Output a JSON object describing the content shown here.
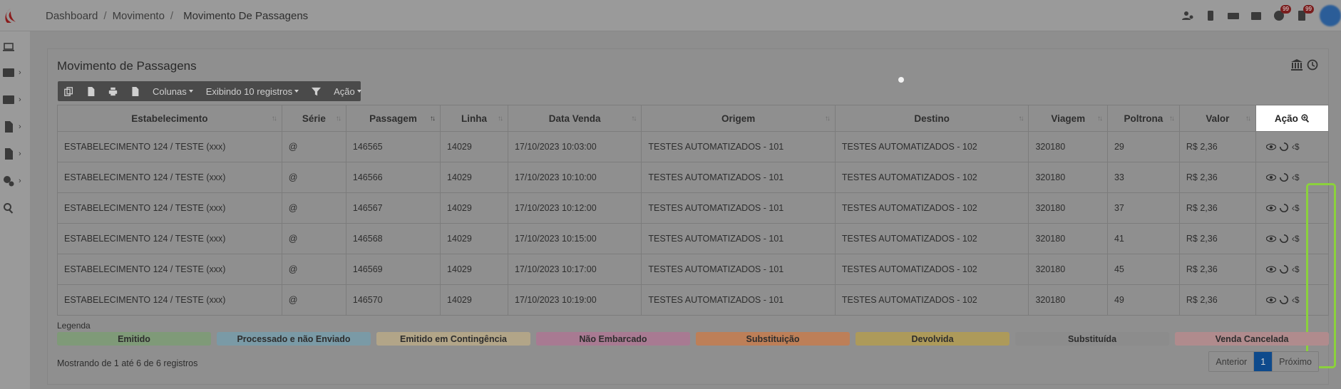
{
  "breadcrumb": {
    "item1": "Dashboard",
    "item2": "Movimento",
    "current": "Movimento De Passagens"
  },
  "topbar": {
    "badge1": "99",
    "badge2": "99"
  },
  "card": {
    "title": "Movimento de Passagens"
  },
  "toolbar": {
    "columns": "Colunas",
    "showing": "Exibindo 10 registros",
    "action": "Ação"
  },
  "table": {
    "headers": [
      "Estabelecimento",
      "Série",
      "Passagem",
      "Linha",
      "Data Venda",
      "Origem",
      "Destino",
      "Viagem",
      "Poltrona",
      "Valor",
      "Ação"
    ],
    "rows": [
      [
        "ESTABELECIMENTO 124 / TESTE (xxx)",
        "@",
        "146565",
        "14029",
        "17/10/2023 10:03:00",
        "TESTES AUTOMATIZADOS - 101",
        "TESTES AUTOMATIZADOS - 102",
        "320180",
        "29",
        "R$ 2,36"
      ],
      [
        "ESTABELECIMENTO 124 / TESTE (xxx)",
        "@",
        "146566",
        "14029",
        "17/10/2023 10:10:00",
        "TESTES AUTOMATIZADOS - 101",
        "TESTES AUTOMATIZADOS - 102",
        "320180",
        "33",
        "R$ 2,36"
      ],
      [
        "ESTABELECIMENTO 124 / TESTE (xxx)",
        "@",
        "146567",
        "14029",
        "17/10/2023 10:12:00",
        "TESTES AUTOMATIZADOS - 101",
        "TESTES AUTOMATIZADOS - 102",
        "320180",
        "37",
        "R$ 2,36"
      ],
      [
        "ESTABELECIMENTO 124 / TESTE (xxx)",
        "@",
        "146568",
        "14029",
        "17/10/2023 10:15:00",
        "TESTES AUTOMATIZADOS - 101",
        "TESTES AUTOMATIZADOS - 102",
        "320180",
        "41",
        "R$ 2,36"
      ],
      [
        "ESTABELECIMENTO 124 / TESTE (xxx)",
        "@",
        "146569",
        "14029",
        "17/10/2023 10:17:00",
        "TESTES AUTOMATIZADOS - 101",
        "TESTES AUTOMATIZADOS - 102",
        "320180",
        "45",
        "R$ 2,36"
      ],
      [
        "ESTABELECIMENTO 124 / TESTE (xxx)",
        "@",
        "146570",
        "14029",
        "17/10/2023 10:19:00",
        "TESTES AUTOMATIZADOS - 101",
        "TESTES AUTOMATIZADOS - 102",
        "320180",
        "49",
        "R$ 2,36"
      ]
    ],
    "action_currency": "$"
  },
  "legend": {
    "label": "Legenda",
    "items": [
      {
        "label": "Emitido",
        "color": "#7f9a78"
      },
      {
        "label": "Processado e não Enviado",
        "color": "#7a9aa6"
      },
      {
        "label": "Emitido em Contingência",
        "color": "#b2a588"
      },
      {
        "label": "Não Embarcado",
        "color": "#a87a92"
      },
      {
        "label": "Substituição",
        "color": "#bd7f58"
      },
      {
        "label": "Devolvida",
        "color": "#ad9a5a"
      },
      {
        "label": "Substituída",
        "color": "#8c8c8c"
      },
      {
        "label": "Venda Cancelada",
        "color": "#b08b8d"
      }
    ]
  },
  "footer": {
    "info": "Mostrando de 1 até 6 de 6 registros",
    "prev": "Anterior",
    "page": "1",
    "next": "Próximo"
  },
  "colors": {
    "highlight": "#8bd13c",
    "active_page": "#0e4a8c"
  }
}
